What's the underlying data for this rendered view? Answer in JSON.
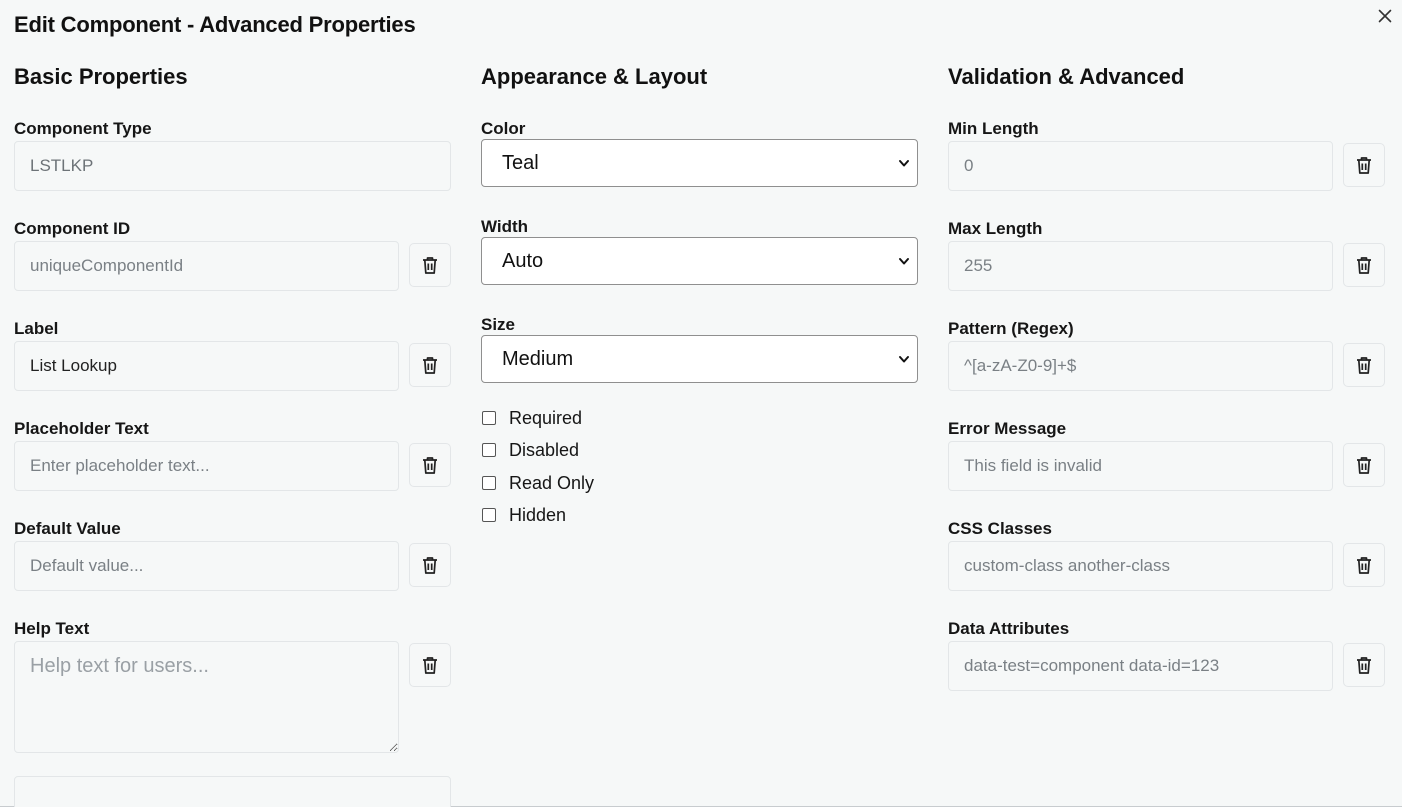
{
  "dialog": {
    "title": "Edit Component - Advanced Properties"
  },
  "basic": {
    "title": "Basic Properties",
    "component_type": {
      "label": "Component Type",
      "value": "LSTLKP"
    },
    "component_id": {
      "label": "Component ID",
      "placeholder": "uniqueComponentId"
    },
    "label": {
      "label": "Label",
      "value": "List Lookup"
    },
    "placeholder_text": {
      "label": "Placeholder Text",
      "placeholder": "Enter placeholder text..."
    },
    "default_value": {
      "label": "Default Value",
      "placeholder": "Default value..."
    },
    "help_text": {
      "label": "Help Text",
      "placeholder": "Help text for users..."
    }
  },
  "appearance": {
    "title": "Appearance & Layout",
    "color": {
      "label": "Color",
      "selected": "Teal"
    },
    "width": {
      "label": "Width",
      "selected": "Auto"
    },
    "size": {
      "label": "Size",
      "selected": "Medium"
    },
    "checkboxes": [
      {
        "label": "Required",
        "checked": false
      },
      {
        "label": "Disabled",
        "checked": false
      },
      {
        "label": "Read Only",
        "checked": false
      },
      {
        "label": "Hidden",
        "checked": false
      }
    ]
  },
  "validation": {
    "title": "Validation & Advanced",
    "min_length": {
      "label": "Min Length",
      "placeholder": "0"
    },
    "max_length": {
      "label": "Max Length",
      "placeholder": "255"
    },
    "pattern": {
      "label": "Pattern (Regex)",
      "placeholder": "^[a-zA-Z0-9]+$"
    },
    "error_message": {
      "label": "Error Message",
      "placeholder": "This field is invalid"
    },
    "css_classes": {
      "label": "CSS Classes",
      "placeholder": "custom-class another-class"
    },
    "data_attributes": {
      "label": "Data Attributes",
      "placeholder": "data-test=component data-id=123"
    }
  },
  "icons": {
    "close": "close-icon",
    "delete": "trash-icon",
    "dropdown": "chevron-down-icon"
  }
}
